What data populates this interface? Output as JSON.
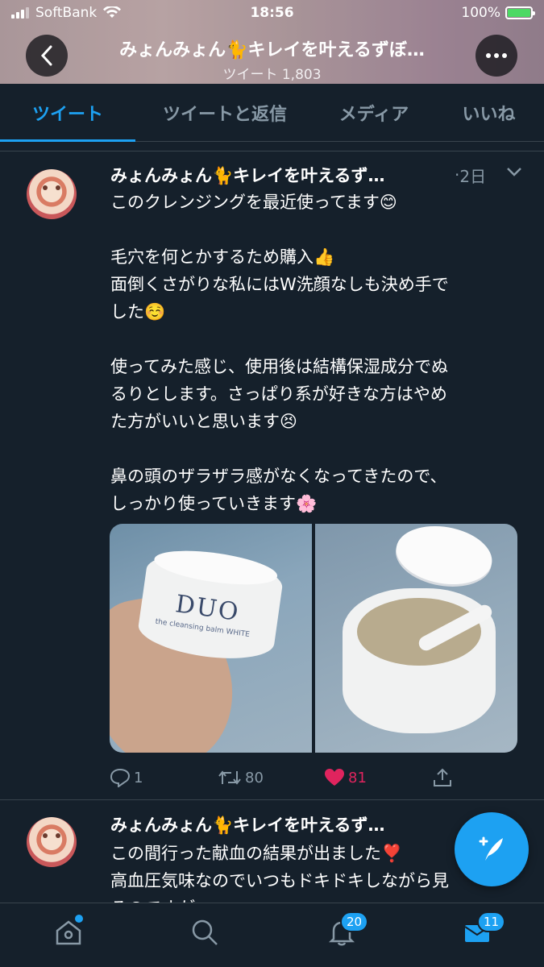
{
  "status_bar": {
    "carrier": "SoftBank",
    "time": "18:56",
    "battery": "100%"
  },
  "header": {
    "name": "みょんみょん🐈キレイを叶えるずぼ…",
    "tweet_count": "ツイート 1,803"
  },
  "tabs": [
    {
      "label": "ツイート",
      "active": true
    },
    {
      "label": "ツイートと返信",
      "active": false
    },
    {
      "label": "メディア",
      "active": false
    },
    {
      "label": "いいね",
      "active": false
    }
  ],
  "tweets": [
    {
      "name": "みょんみょん🐈キレイを叶えるず…",
      "dot": "·",
      "time": "2日",
      "lines": [
        "このクレンジングを最近使ってます😊",
        "",
        "毛穴を何とかするため購入👍",
        "面倒くさがりな私にはW洗顔なしも決め手で",
        "した☺️",
        "",
        "使ってみた感じ、使用後は結構保湿成分でぬ",
        "るりとします。さっぱり系が好きな方はやめ",
        "た方がいいと思います😣",
        "",
        "鼻の頭のザラザラ感がなくなってきたので、",
        "しっかり使っていきます🌸"
      ],
      "media_text": "DUO",
      "media_subtext": "the cleansing balm WHITE",
      "replies": "1",
      "retweets": "80",
      "likes": "81"
    },
    {
      "name": "みょんみょん🐈キレイを叶えるず…",
      "lines": [
        "この間行った献血の結果が出ました❣️",
        "高血圧気味なのでいつもドキドキしながら見",
        "るのですが、…"
      ]
    }
  ],
  "bottom_nav": {
    "notifications_badge": "20",
    "messages_badge": "11"
  },
  "colors": {
    "background": "#15202b",
    "accent": "#1da1f2",
    "like": "#e0245e",
    "muted": "#8899a6"
  }
}
